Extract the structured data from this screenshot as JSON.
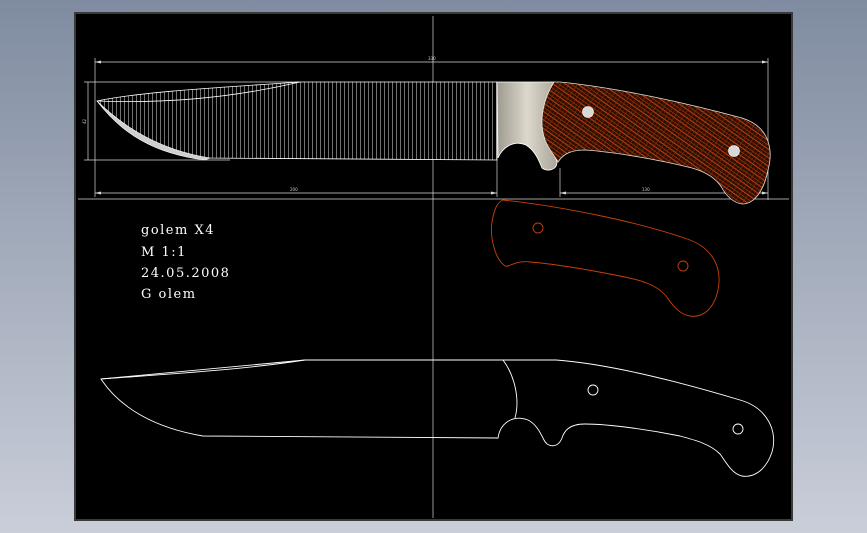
{
  "drawing": {
    "title_block": {
      "name": "golem  X4",
      "scale": "M  1:1",
      "date": "24.05.2008",
      "author": "G olem"
    },
    "dimensions": {
      "overall_length": "330",
      "blade_length": "200",
      "handle_length": "130",
      "blade_height": "42"
    },
    "colors": {
      "background": "#000000",
      "outline": "#ffffff",
      "scale_pattern": "#c8400a",
      "guard_metal": "#c8c4b8",
      "frame_border": "#3a3a3a"
    }
  }
}
